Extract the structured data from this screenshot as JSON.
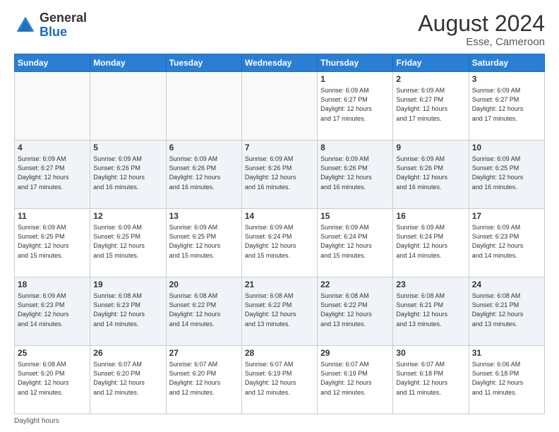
{
  "header": {
    "logo_general": "General",
    "logo_blue": "Blue",
    "month_year": "August 2024",
    "location": "Esse, Cameroon"
  },
  "footer": {
    "note": "Daylight hours"
  },
  "weekdays": [
    "Sunday",
    "Monday",
    "Tuesday",
    "Wednesday",
    "Thursday",
    "Friday",
    "Saturday"
  ],
  "weeks": [
    [
      {
        "day": "",
        "info": ""
      },
      {
        "day": "",
        "info": ""
      },
      {
        "day": "",
        "info": ""
      },
      {
        "day": "",
        "info": ""
      },
      {
        "day": "1",
        "info": "Sunrise: 6:09 AM\nSunset: 6:27 PM\nDaylight: 12 hours\nand 17 minutes."
      },
      {
        "day": "2",
        "info": "Sunrise: 6:09 AM\nSunset: 6:27 PM\nDaylight: 12 hours\nand 17 minutes."
      },
      {
        "day": "3",
        "info": "Sunrise: 6:09 AM\nSunset: 6:27 PM\nDaylight: 12 hours\nand 17 minutes."
      }
    ],
    [
      {
        "day": "4",
        "info": "Sunrise: 6:09 AM\nSunset: 6:27 PM\nDaylight: 12 hours\nand 17 minutes."
      },
      {
        "day": "5",
        "info": "Sunrise: 6:09 AM\nSunset: 6:26 PM\nDaylight: 12 hours\nand 16 minutes."
      },
      {
        "day": "6",
        "info": "Sunrise: 6:09 AM\nSunset: 6:26 PM\nDaylight: 12 hours\nand 16 minutes."
      },
      {
        "day": "7",
        "info": "Sunrise: 6:09 AM\nSunset: 6:26 PM\nDaylight: 12 hours\nand 16 minutes."
      },
      {
        "day": "8",
        "info": "Sunrise: 6:09 AM\nSunset: 6:26 PM\nDaylight: 12 hours\nand 16 minutes."
      },
      {
        "day": "9",
        "info": "Sunrise: 6:09 AM\nSunset: 6:26 PM\nDaylight: 12 hours\nand 16 minutes."
      },
      {
        "day": "10",
        "info": "Sunrise: 6:09 AM\nSunset: 6:25 PM\nDaylight: 12 hours\nand 16 minutes."
      }
    ],
    [
      {
        "day": "11",
        "info": "Sunrise: 6:09 AM\nSunset: 6:25 PM\nDaylight: 12 hours\nand 15 minutes."
      },
      {
        "day": "12",
        "info": "Sunrise: 6:09 AM\nSunset: 6:25 PM\nDaylight: 12 hours\nand 15 minutes."
      },
      {
        "day": "13",
        "info": "Sunrise: 6:09 AM\nSunset: 6:25 PM\nDaylight: 12 hours\nand 15 minutes."
      },
      {
        "day": "14",
        "info": "Sunrise: 6:09 AM\nSunset: 6:24 PM\nDaylight: 12 hours\nand 15 minutes."
      },
      {
        "day": "15",
        "info": "Sunrise: 6:09 AM\nSunset: 6:24 PM\nDaylight: 12 hours\nand 15 minutes."
      },
      {
        "day": "16",
        "info": "Sunrise: 6:09 AM\nSunset: 6:24 PM\nDaylight: 12 hours\nand 14 minutes."
      },
      {
        "day": "17",
        "info": "Sunrise: 6:09 AM\nSunset: 6:23 PM\nDaylight: 12 hours\nand 14 minutes."
      }
    ],
    [
      {
        "day": "18",
        "info": "Sunrise: 6:09 AM\nSunset: 6:23 PM\nDaylight: 12 hours\nand 14 minutes."
      },
      {
        "day": "19",
        "info": "Sunrise: 6:08 AM\nSunset: 6:23 PM\nDaylight: 12 hours\nand 14 minutes."
      },
      {
        "day": "20",
        "info": "Sunrise: 6:08 AM\nSunset: 6:22 PM\nDaylight: 12 hours\nand 14 minutes."
      },
      {
        "day": "21",
        "info": "Sunrise: 6:08 AM\nSunset: 6:22 PM\nDaylight: 12 hours\nand 13 minutes."
      },
      {
        "day": "22",
        "info": "Sunrise: 6:08 AM\nSunset: 6:22 PM\nDaylight: 12 hours\nand 13 minutes."
      },
      {
        "day": "23",
        "info": "Sunrise: 6:08 AM\nSunset: 6:21 PM\nDaylight: 12 hours\nand 13 minutes."
      },
      {
        "day": "24",
        "info": "Sunrise: 6:08 AM\nSunset: 6:21 PM\nDaylight: 12 hours\nand 13 minutes."
      }
    ],
    [
      {
        "day": "25",
        "info": "Sunrise: 6:08 AM\nSunset: 6:20 PM\nDaylight: 12 hours\nand 12 minutes."
      },
      {
        "day": "26",
        "info": "Sunrise: 6:07 AM\nSunset: 6:20 PM\nDaylight: 12 hours\nand 12 minutes."
      },
      {
        "day": "27",
        "info": "Sunrise: 6:07 AM\nSunset: 6:20 PM\nDaylight: 12 hours\nand 12 minutes."
      },
      {
        "day": "28",
        "info": "Sunrise: 6:07 AM\nSunset: 6:19 PM\nDaylight: 12 hours\nand 12 minutes."
      },
      {
        "day": "29",
        "info": "Sunrise: 6:07 AM\nSunset: 6:19 PM\nDaylight: 12 hours\nand 12 minutes."
      },
      {
        "day": "30",
        "info": "Sunrise: 6:07 AM\nSunset: 6:18 PM\nDaylight: 12 hours\nand 11 minutes."
      },
      {
        "day": "31",
        "info": "Sunrise: 6:06 AM\nSunset: 6:18 PM\nDaylight: 12 hours\nand 11 minutes."
      }
    ]
  ]
}
